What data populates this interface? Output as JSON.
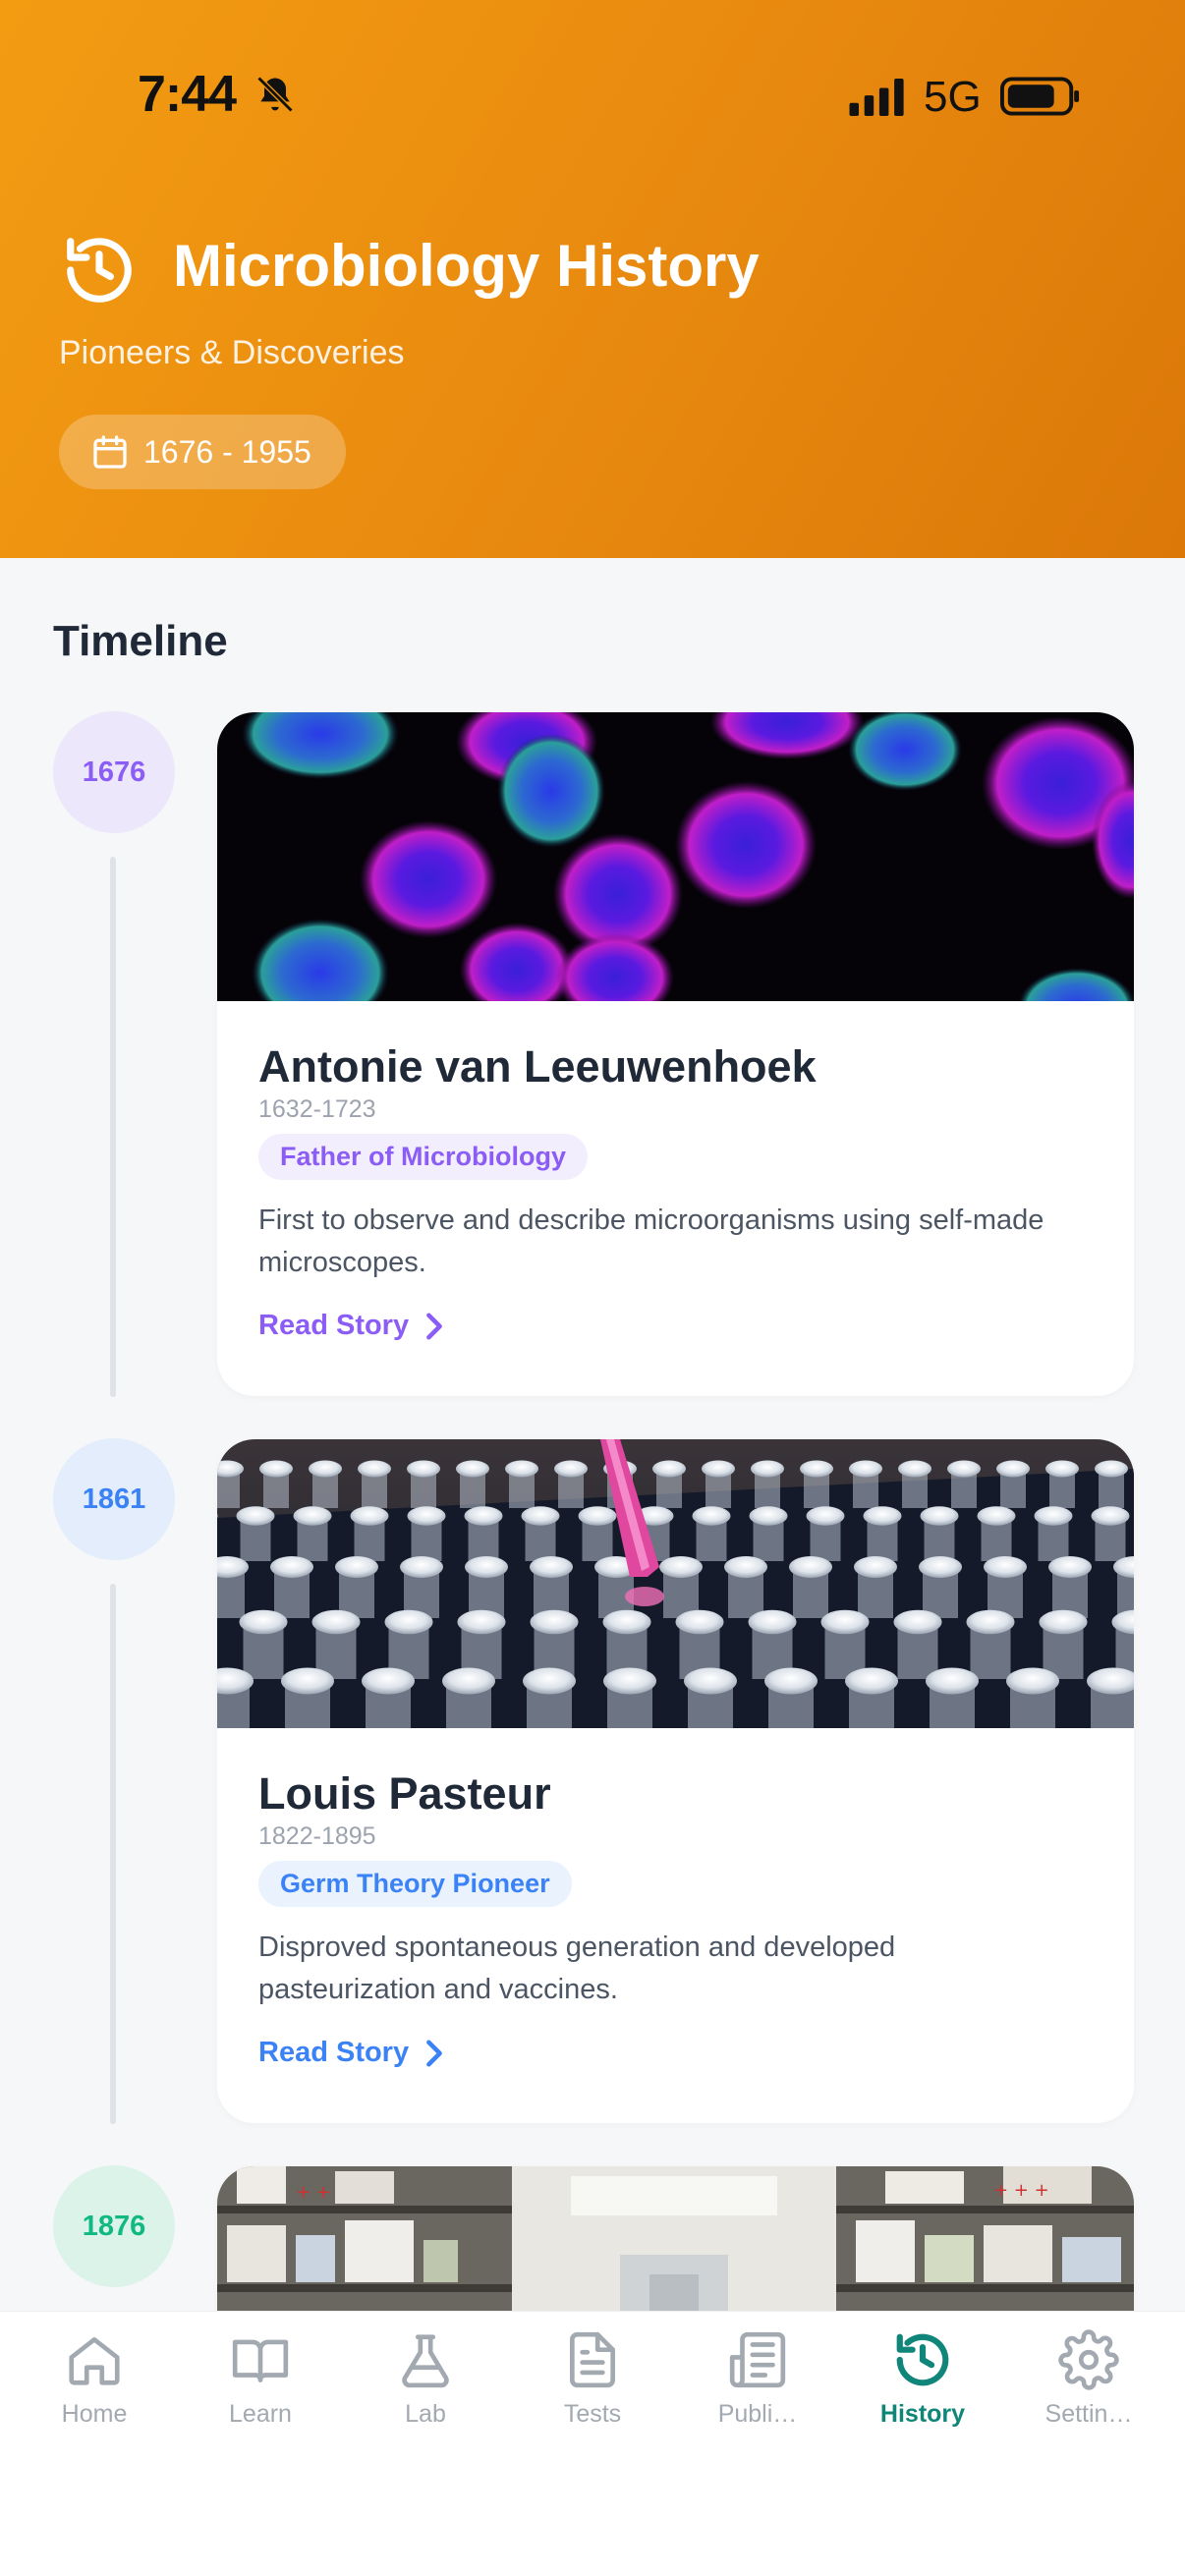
{
  "status_bar": {
    "time": "7:44",
    "network": "5G"
  },
  "header": {
    "title": "Microbiology History",
    "subtitle": "Pioneers & Discoveries",
    "date_range": "1676 - 1955",
    "gradient_start": "#f39c12",
    "gradient_end": "#db7808"
  },
  "timeline": {
    "section_title": "Timeline",
    "entries": [
      {
        "year": "1676",
        "name": "Antonie van Leeuwenhoek",
        "years": "1632-1723",
        "role": "Father of Microbiology",
        "description": "First to observe and describe microorganisms using self-made microscopes.",
        "cta": "Read Story",
        "accent": "#8b5cf6",
        "badge_bg": "#f3eefe",
        "circle_bg": "#ede7fb",
        "image": "fluorescent-cells-image"
      },
      {
        "year": "1861",
        "name": "Louis Pasteur",
        "years": "1822-1895",
        "role": "Germ Theory Pioneer",
        "description": "Disproved spontaneous generation and developed pasteurization and vaccines.",
        "cta": "Read Story",
        "accent": "#3b82f6",
        "badge_bg": "#eaf2fe",
        "circle_bg": "#e3edfc",
        "image": "pipette-tubes-image"
      },
      {
        "year": "1876",
        "accent": "#10b981",
        "circle_bg": "#dcf3ea",
        "image": "laboratory-image"
      }
    ]
  },
  "tabs": [
    {
      "label": "Home",
      "icon": "home-icon"
    },
    {
      "label": "Learn",
      "icon": "book-icon"
    },
    {
      "label": "Lab",
      "icon": "flask-icon"
    },
    {
      "label": "Tests",
      "icon": "document-icon"
    },
    {
      "label": "Publi…",
      "icon": "newspaper-icon"
    },
    {
      "label": "History",
      "icon": "history-icon",
      "active": true
    },
    {
      "label": "Settin…",
      "icon": "gear-icon"
    }
  ],
  "colors": {
    "active_tab": "#10857a",
    "inactive_tab": "#a3a9b1"
  }
}
